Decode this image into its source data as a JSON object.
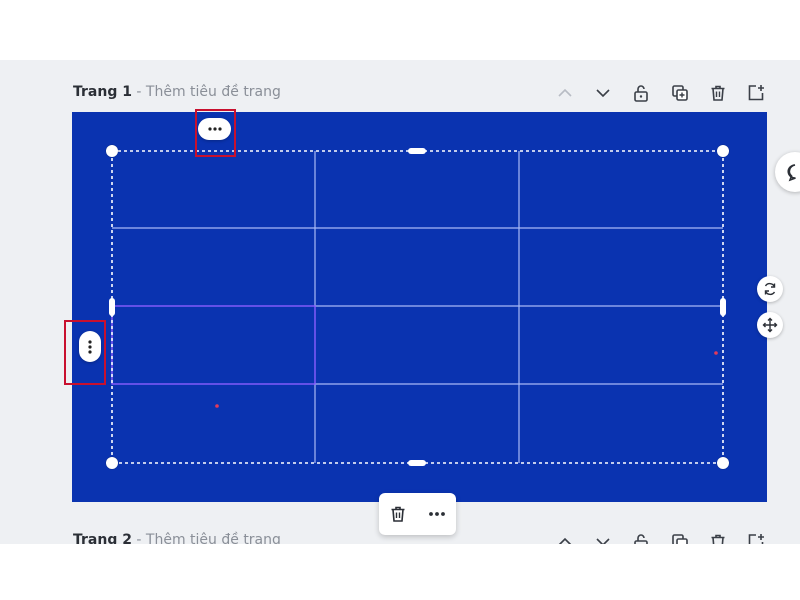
{
  "pages": [
    {
      "name": "Trang 1",
      "separator": " - ",
      "subtitle": "Thêm tiêu đề trang"
    },
    {
      "name": "Trang 2",
      "separator": " - ",
      "subtitle": "Thêm tiêu đề trang"
    }
  ],
  "page_toolbar_icons": [
    "chevron-up-icon",
    "chevron-down-icon",
    "unlock-icon",
    "duplicate-icon",
    "trash-icon",
    "add-page-icon"
  ],
  "table": {
    "rows": 4,
    "columns": 3
  },
  "float_toolbar_icons": [
    "trash-icon",
    "more-icon"
  ],
  "colors": {
    "canvas": "#0a33b0",
    "grid_line": "#a9b9f5",
    "selected_cell_line": "#8a5cff",
    "highlight": "#c8102e",
    "editor_background": "#eef0f3"
  }
}
